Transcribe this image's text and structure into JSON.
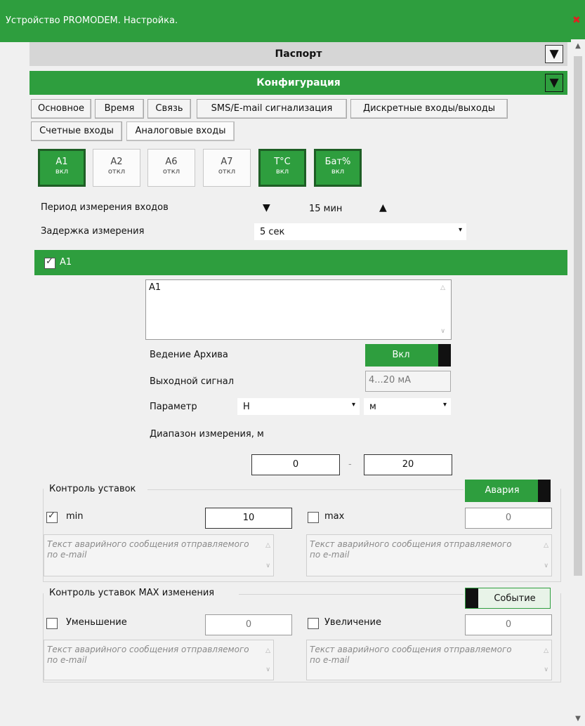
{
  "window": {
    "title": "Устройство PROMODEM. Настройка.",
    "close_icon": "close-icon"
  },
  "sections": {
    "passport": "Паспорт",
    "config": "Конфигурация",
    "collapse_glyph": "▼"
  },
  "tabs": {
    "row1": [
      "Основное",
      "Время",
      "Связь",
      "SMS/E-mail  сигнализация",
      "Дискретные входы/выходы"
    ],
    "row2": [
      "Счетные входы",
      "Аналоговые входы"
    ],
    "selected": "Аналоговые входы"
  },
  "channels": [
    {
      "name": "A1",
      "state": "вкл",
      "on": true
    },
    {
      "name": "A2",
      "state": "откл",
      "on": false
    },
    {
      "name": "A6",
      "state": "откл",
      "on": false
    },
    {
      "name": "A7",
      "state": "откл",
      "on": false
    },
    {
      "name": "T°C",
      "state": "вкл",
      "on": true
    },
    {
      "name": "Бат%",
      "state": "вкл",
      "on": true
    }
  ],
  "period": {
    "label": "Период измерения входов",
    "value": "15 мин",
    "down": "▼",
    "up": "▲"
  },
  "delay": {
    "label": "Задержка измерения",
    "value": "5 сек",
    "dd": "▾"
  },
  "channel_panel": {
    "title": "A1",
    "checked": true,
    "description": "A1",
    "archive": {
      "label": "Ведение Архива",
      "toggle": "Вкл"
    },
    "output": {
      "label": "Выходной сигнал",
      "value": "4...20 мА"
    },
    "param": {
      "label": "Параметр",
      "value": "Н",
      "unit": "м"
    },
    "range": {
      "label": "Диапазон измерения, м",
      "from": "0",
      "sep": "-",
      "to": "20"
    }
  },
  "setpoints": {
    "title": "Контроль уставок",
    "toggle": "Авария",
    "min": {
      "label": "min",
      "checked": true,
      "value": "10"
    },
    "max": {
      "label": "max",
      "checked": false,
      "value": "0"
    },
    "msg_placeholder": "Текст аварийного сообщения отправляемого по e-mail"
  },
  "rate": {
    "title": "Контроль уставок MAX изменения",
    "toggle": "Событие",
    "dec": {
      "label": "Уменьшение",
      "checked": false,
      "value": "0"
    },
    "inc": {
      "label": "Увеличение",
      "checked": false,
      "value": "0"
    },
    "msg_placeholder": "Текст аварийного сообщения отправляемого по e-mail"
  },
  "colors": {
    "green": "#2e9e3e",
    "dark": "#1e5e25"
  }
}
